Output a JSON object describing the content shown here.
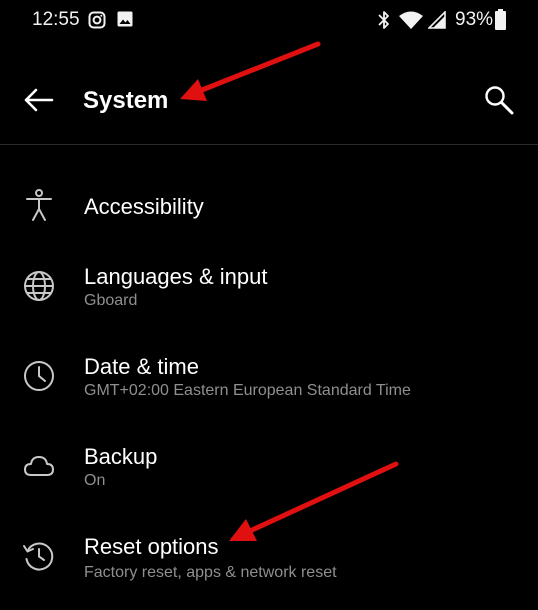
{
  "status_bar": {
    "time": "12:55",
    "battery": "93%"
  },
  "toolbar": {
    "title": "System"
  },
  "items": [
    {
      "label": "Accessibility",
      "sub": ""
    },
    {
      "label": "Languages & input",
      "sub": "Gboard"
    },
    {
      "label": "Date & time",
      "sub": "GMT+02:00 Eastern European Standard Time"
    },
    {
      "label": "Backup",
      "sub": "On"
    },
    {
      "label": "Reset options",
      "sub": "Factory reset, apps & network reset"
    }
  ],
  "colors": {
    "background": "#000000",
    "text": "#ffffff",
    "subtext": "#8f8f8f",
    "annotation_arrow": "#e01010"
  }
}
